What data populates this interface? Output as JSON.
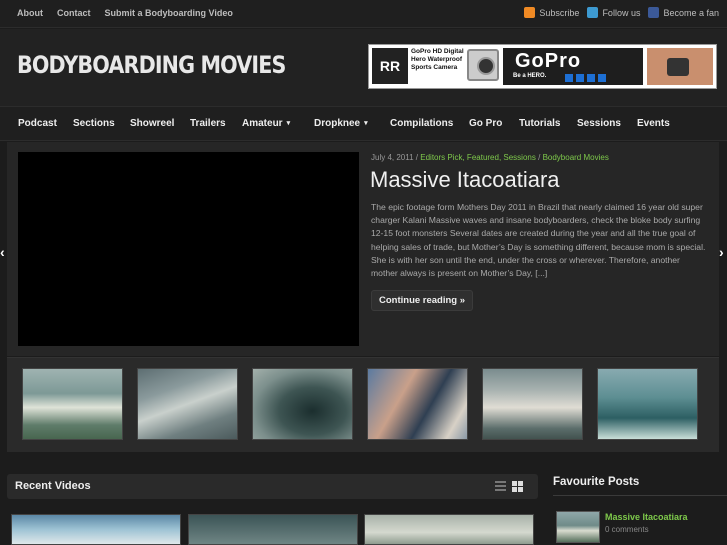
{
  "topbar": {
    "links": [
      "About",
      "Contact",
      "Submit a Bodyboarding Video"
    ],
    "subscribe": "Subscribe",
    "follow": "Follow us",
    "fan": "Become a fan",
    "colors": {
      "rss": "#f08a24",
      "twitter": "#3d9ad1",
      "facebook": "#3b5998"
    }
  },
  "header": {
    "logo": "BODYBOARDING MOVIES",
    "banner": {
      "badge": "RR",
      "text": "GoPro HD Digital Hero Waterproof Sports Camera",
      "brand": "GoPro",
      "tagline": "Be a HERO."
    }
  },
  "nav": {
    "items": [
      "Podcast",
      "Sections",
      "Showreel",
      "Trailers",
      "Amateur",
      "Dropknee",
      "Compilations",
      "Go Pro",
      "Tutorials",
      "Sessions",
      "Events"
    ],
    "dropdown_caret": "▾"
  },
  "featured": {
    "date": "July 4, 2011",
    "separator": "/",
    "categories": "Editors Pick, Featured, Sessions",
    "category2": "Bodyboard Movies",
    "title": "Massive Itacoatiara",
    "excerpt": "The epic footage form Mothers Day 2011 in Brazil that nearly claimed 16 year old super charger Kalani Massive waves and insane bodyboarders, check the bloke body surfing 12-15 foot monsters Several dates are created during the year and all the true goal of helping sales of trade, but Mother’s Day is something different, because mom is special. She is with her son until the end, under the cross or wherever. Therefore, another mother always is present on Mother’s Day, [...]",
    "read_more": "Continue reading »",
    "prev": "‹",
    "next": "›"
  },
  "recent": {
    "title": "Recent Videos"
  },
  "favourites": {
    "title": "Favourite Posts",
    "post_title": "Massive Itacoatiara",
    "comments": "0 comments"
  }
}
